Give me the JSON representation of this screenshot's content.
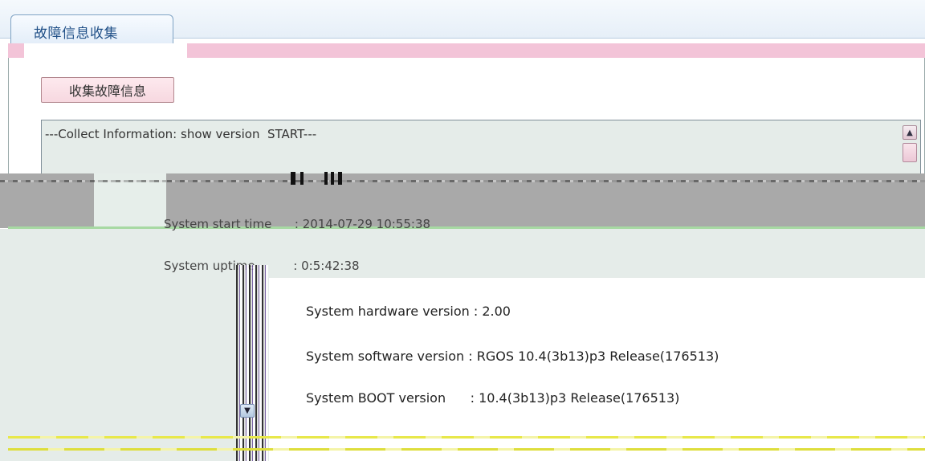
{
  "tab": {
    "label": "故障信息收集"
  },
  "toolbar": {
    "collect_label": "收集故障信息"
  },
  "log": {
    "line_start": "---Collect Information: show version  START---",
    "system_start_label": "System start time      : 2014-07-29 10:55:38",
    "system_uptime_label": "System uptime          : 0:5:42:38",
    "hardware": "System hardware version : 2.00",
    "software": "System software version : RGOS 10.4(3b13)p3 Release(176513)",
    "boot": "System BOOT version      : 10.4(3b13)p3 Release(176513)"
  },
  "icons": {
    "up": "scroll-up-arrow-icon",
    "down": "scroll-down-arrow-icon"
  },
  "colors": {
    "tab_text": "#1f4f87",
    "pink_bar": "#f3c4d8",
    "log_bg": "#e5ece9"
  }
}
